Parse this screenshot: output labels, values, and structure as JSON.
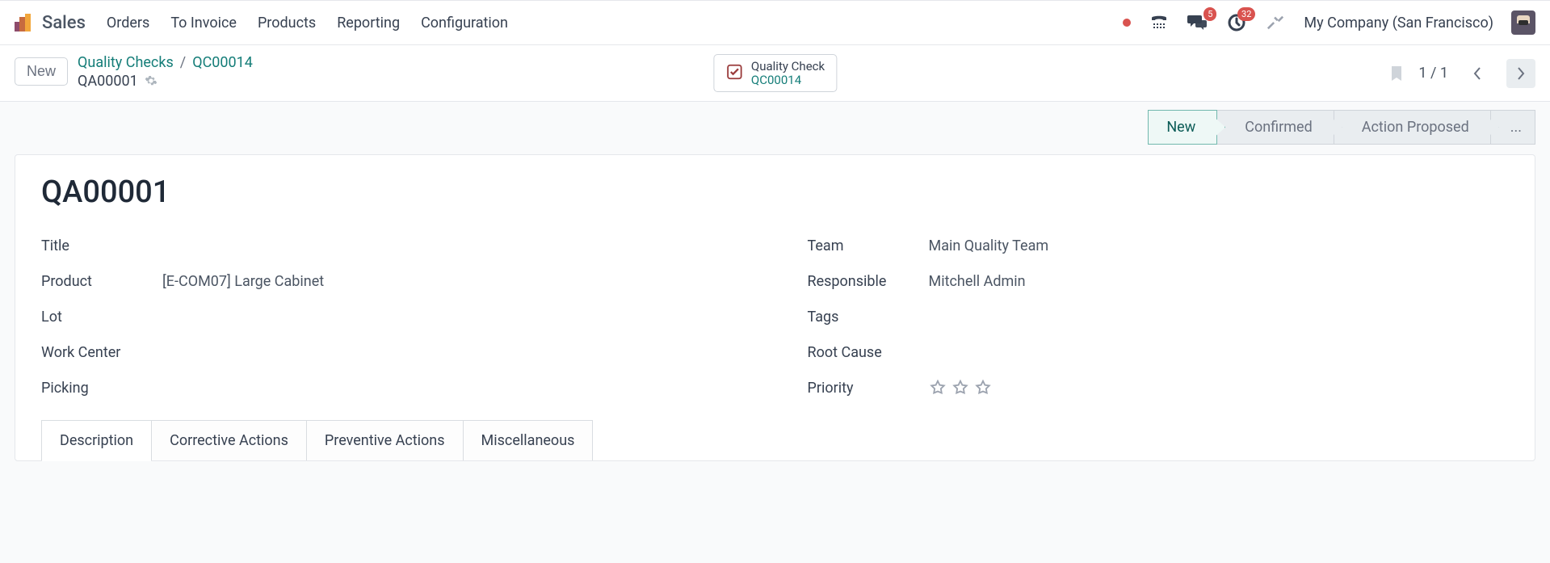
{
  "brand": {
    "title": "Sales"
  },
  "nav": {
    "items": [
      "Orders",
      "To Invoice",
      "Products",
      "Reporting",
      "Configuration"
    ]
  },
  "systray": {
    "messages_badge": "5",
    "activities_badge": "32",
    "company": "My Company (San Francisco)"
  },
  "controlbar": {
    "new_label": "New",
    "breadcrumb": {
      "root": "Quality Checks",
      "parent": "QC00014",
      "current": "QA00001"
    },
    "quality_check": {
      "label": "Quality Check",
      "ref": "QC00014"
    },
    "pager": "1 / 1"
  },
  "statusbar": {
    "stages": [
      "New",
      "Confirmed",
      "Action Proposed"
    ],
    "more": "...",
    "active_index": 0
  },
  "record": {
    "name": "QA00001",
    "left": {
      "title_label": "Title",
      "title_value": "",
      "product_label": "Product",
      "product_value": "[E-COM07] Large Cabinet",
      "lot_label": "Lot",
      "lot_value": "",
      "workcenter_label": "Work Center",
      "workcenter_value": "",
      "picking_label": "Picking",
      "picking_value": ""
    },
    "right": {
      "team_label": "Team",
      "team_value": "Main Quality Team",
      "responsible_label": "Responsible",
      "responsible_value": "Mitchell Admin",
      "tags_label": "Tags",
      "tags_value": "",
      "rootcause_label": "Root Cause",
      "rootcause_value": "",
      "priority_label": "Priority"
    }
  },
  "tabs": {
    "items": [
      "Description",
      "Corrective Actions",
      "Preventive Actions",
      "Miscellaneous"
    ],
    "active_index": 0
  }
}
